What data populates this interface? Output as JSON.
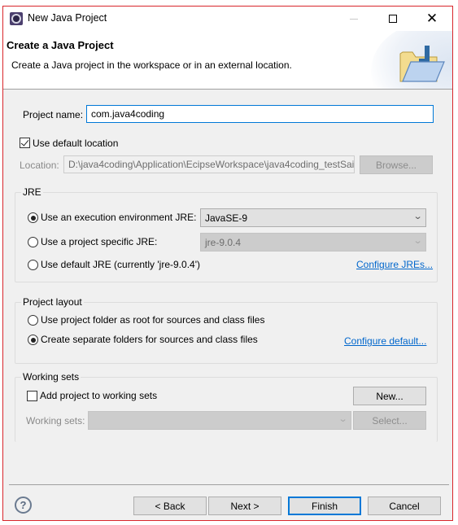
{
  "window": {
    "title": "New Java Project",
    "controls": {
      "minimize": "—",
      "maximize": "☐",
      "close": "✕"
    }
  },
  "banner": {
    "title": "Create a Java Project",
    "description": "Create a Java project in the workspace or in an external location.",
    "icon": "open-folder-icon"
  },
  "project": {
    "name_label": "Project name:",
    "name_value": "com.java4coding",
    "use_default_location_label": "Use default location",
    "use_default_location_checked": true,
    "location_label": "Location:",
    "location_value": "D:\\java4coding\\Application\\EcipseWorkspace\\java4coding_testSai",
    "browse_label": "Browse..."
  },
  "jre": {
    "group_title": "JRE",
    "options": [
      {
        "label": "Use an execution environment JRE:",
        "selected": true
      },
      {
        "label": "Use a project specific JRE:",
        "selected": false
      },
      {
        "label": "Use default JRE (currently 'jre-9.0.4')",
        "selected": false
      }
    ],
    "execution_env_value": "JavaSE-9",
    "project_specific_value": "jre-9.0.4",
    "configure_link": "Configure JREs..."
  },
  "layout": {
    "group_title": "Project layout",
    "options": [
      {
        "label": "Use project folder as root for sources and class files",
        "selected": false
      },
      {
        "label": "Create separate folders for sources and class files",
        "selected": true
      }
    ],
    "configure_link": "Configure default..."
  },
  "working_sets": {
    "group_title": "Working sets",
    "add_label": "Add project to working sets",
    "add_checked": false,
    "new_label": "New...",
    "sets_label": "Working sets:",
    "sets_value": "",
    "select_label": "Select..."
  },
  "footer": {
    "help": "?",
    "back": "< Back",
    "next": "Next >",
    "finish": "Finish",
    "cancel": "Cancel"
  }
}
